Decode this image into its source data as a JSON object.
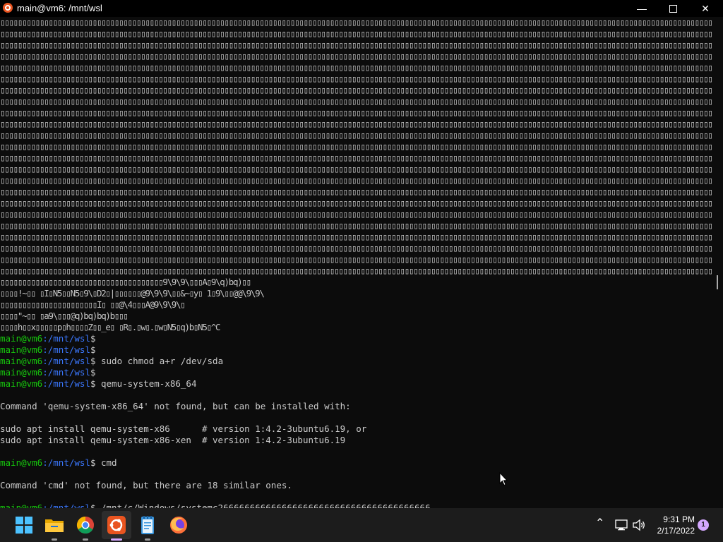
{
  "window": {
    "title": "main@vm6: /mnt/wsl",
    "minimize_glyph": "—",
    "close_glyph": "✕"
  },
  "terminal": {
    "garbage_line": "▯▯▯▯▯▯▯▯▯▯▯▯▯▯▯▯▯▯▯▯▯▯▯▯▯▯▯▯▯▯▯▯▯▯▯▯▯▯▯▯▯▯▯▯▯▯▯▯▯▯▯▯▯▯▯▯▯▯▯▯▯▯▯▯▯▯▯▯▯▯▯▯▯▯▯▯▯▯▯▯▯▯▯▯▯▯▯▯▯▯▯▯▯▯▯▯▯▯▯▯▯▯▯▯▯▯▯▯▯▯▯▯▯▯▯▯▯▯▯▯▯▯▯▯▯▯▯▯▯▯▯▯▯▯▯▯▯▯▯▯▯▯▯▯▯▯▯▯▯▯▯▯▯▯▯▯▯▯▯▯▯▯▯▯",
    "tail_lines": [
      "▯▯▯▯▯▯▯▯▯▯▯▯▯▯▯▯▯▯▯▯▯▯▯▯▯▯▯▯▯▯▯▯▯▯▯▯▯9\\9\\9\\▯▯▯A▯9\\q)bq)▯▯",
      "▯▯▯▯!~▯▯ ▯I▯N5▯▯N5▯9\\▯D2▯|▯▯▯▯▯▯@9\\9\\9\\▯▯&~▯y▯ 1▯9\\▯▯@@\\9\\9\\",
      "▯▯▯▯▯▯▯▯▯▯▯▯▯▯▯▯▯▯▯▯▯▯I▯ ▯▯@\\4▯▯▯A@9\\9\\9\\▯",
      "▯▯▯▯\"~▯▯ ▯a9\\▯▯▯@q)bq)bq)b▯▯▯",
      "▯▯▯▯h▯▯x▯▯▯▯▯p▯h▯▯▯▯Z▯▯_e▯ ▯R▯.▯w▯.▯w▯N5▯q)b▯N5▯^C"
    ],
    "prompt_user": "main@vm6",
    "prompt_path": ":/mnt/wsl",
    "prompt_symbol": "$",
    "cmd_chmod": " sudo chmod a+r /dev/sda",
    "cmd_qemu": " qemu-system-x86_64",
    "qemu_not_found": "Command 'qemu-system-x86_64' not found, but can be installed with:",
    "apt_line_1": "sudo apt install qemu-system-x86      # version 1:4.2-3ubuntu6.19, or",
    "apt_line_2": "sudo apt install qemu-system-x86-xen  # version 1:4.2-3ubuntu6.19",
    "cmd_cmd": " cmd",
    "cmd_not_found": "Command 'cmd' not found, but there are 18 similar ones.",
    "cmd_current": " /mnt/c/Windows/systemc2666666666666666666666666666666666666666"
  },
  "taskbar": {
    "icons": [
      "windows-start-icon",
      "file-explorer-icon",
      "chrome-icon",
      "ubuntu-icon",
      "notepad-icon",
      "firefox-icon"
    ],
    "tray": {
      "chevron_glyph": "⌃",
      "time": "9:31 PM",
      "date": "2/17/2022",
      "notification_count": "1"
    }
  }
}
